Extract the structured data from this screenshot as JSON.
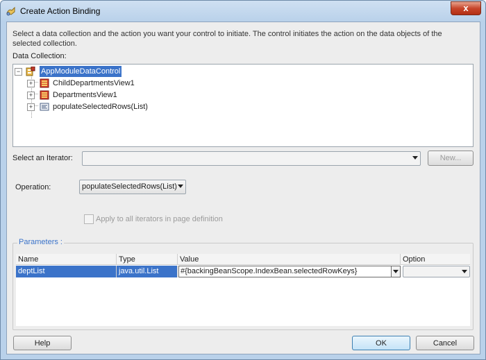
{
  "window": {
    "title": "Create Action Binding",
    "close_glyph": "x"
  },
  "description": "Select a data collection and the action you want your control to initiate. The control initiates the action on the data objects of the selected collection.",
  "data_collection": {
    "label": "Data Collection:",
    "tree": [
      {
        "label": "AppModuleDataControl",
        "icon": "data-control-icon",
        "expand": "-",
        "selected": true
      },
      {
        "label": "ChildDepartmentsView1",
        "icon": "view-object-icon",
        "expand": "+"
      },
      {
        "label": "DepartmentsView1",
        "icon": "view-object-icon",
        "expand": "+"
      },
      {
        "label": "populateSelectedRows(List)",
        "icon": "method-icon",
        "expand": "+"
      }
    ]
  },
  "iterator": {
    "label": "Select an Iterator:",
    "value": "",
    "new_button": "New..."
  },
  "operation": {
    "label": "Operation:",
    "value": "populateSelectedRows(List)"
  },
  "apply_all": {
    "label": "Apply to all iterators in page definition",
    "checked": false,
    "enabled": false
  },
  "parameters": {
    "legend": "Parameters :",
    "columns": [
      "Name",
      "Type",
      "Value",
      "Option"
    ],
    "rows": [
      {
        "name": "deptList",
        "type": "java.util.List",
        "value": "#{backingBeanScope.IndexBean.selectedRowKeys}",
        "option": ""
      }
    ]
  },
  "buttons": {
    "help": "Help",
    "ok": "OK",
    "cancel": "Cancel"
  },
  "colors": {
    "selection": "#3b73c9",
    "legend": "#3b73c9",
    "close_button": "#c7462b"
  }
}
